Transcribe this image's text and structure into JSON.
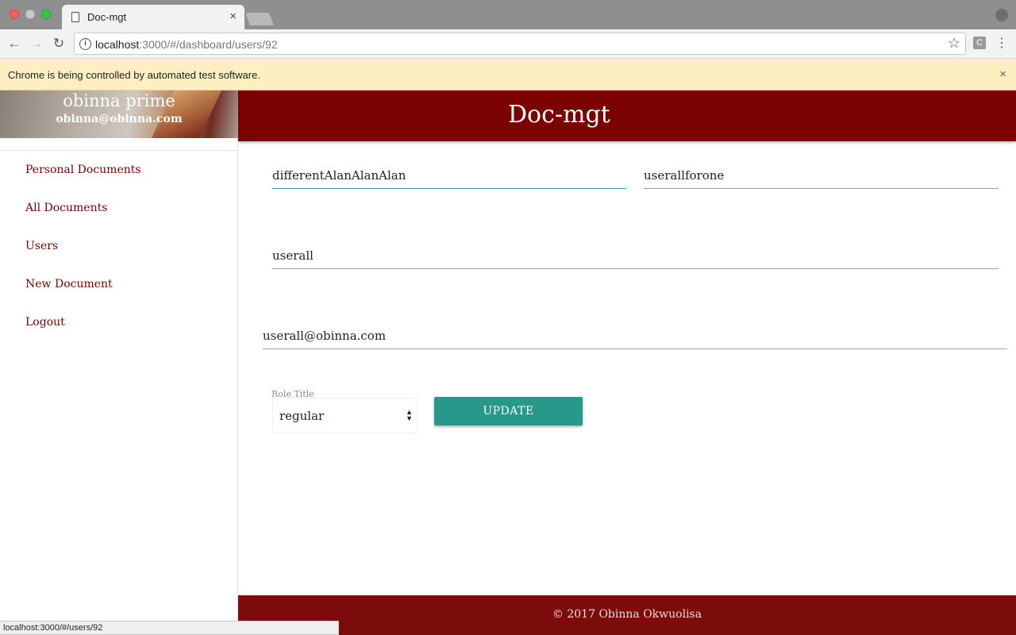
{
  "browser": {
    "tab_title": "Doc-mgt",
    "tab_close": "×",
    "url_host": "localhost",
    "url_rest": ":3000/#/dashboard/users/92",
    "infobar_text": "Chrome is being controlled by automated test software.",
    "infobar_close": "×",
    "extension_label": "C",
    "status_url": "localhost:3000/#/users/92"
  },
  "header": {
    "brand": "Doc-mgt"
  },
  "sidebar": {
    "user_name": "obinna prime",
    "user_email": "obinna@obinna.com",
    "items": [
      {
        "label": "Personal Documents"
      },
      {
        "label": "All Documents"
      },
      {
        "label": "Users"
      },
      {
        "label": "New Document"
      },
      {
        "label": "Logout"
      }
    ]
  },
  "form": {
    "first_name": "differentAlanAlanAlan",
    "last_name": "userallforone",
    "username": "userall",
    "email": "userall@obinna.com",
    "role_label": "Role Title",
    "role_value": "regular",
    "update_label": "UPDATE"
  },
  "footer": {
    "text": "© 2017 Obinna Okwuolisa"
  },
  "colors": {
    "primary": "#7c0101",
    "accent": "#26998a",
    "infobar": "#fdefc1"
  }
}
